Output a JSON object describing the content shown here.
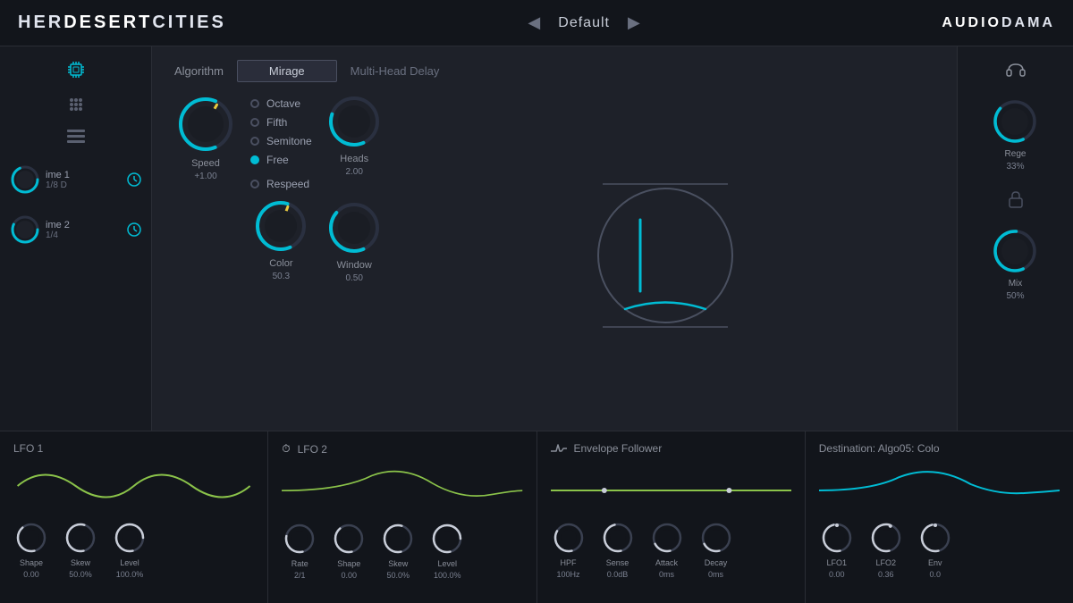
{
  "header": {
    "title_part1": "HER",
    "title_part2": "DESERT",
    "title_part3": "CITIES",
    "preset": "Default",
    "brand_part1": "AUDIO",
    "brand_part2": "DAMA",
    "arrow_left": "◀",
    "arrow_right": "▶"
  },
  "algorithm": {
    "label": "Algorithm",
    "selected": "Mirage",
    "other": "Multi-Head Delay"
  },
  "radio_options": [
    {
      "label": "Octave",
      "active": false
    },
    {
      "label": "Fifth",
      "active": false
    },
    {
      "label": "Semitone",
      "active": false
    },
    {
      "label": "Free",
      "active": true
    }
  ],
  "respeed": {
    "label": "Respeed",
    "active": false
  },
  "knobs": {
    "speed": {
      "label": "Speed",
      "value": "+1.00"
    },
    "color": {
      "label": "Color",
      "value": "50.3"
    },
    "heads": {
      "label": "Heads",
      "value": "2.00"
    },
    "window": {
      "label": "Window",
      "value": "0.50"
    }
  },
  "left_knobs": [
    {
      "label": "me 1",
      "sublabel": "1/8 D"
    },
    {
      "label": "me 2",
      "sublabel": "1/4"
    }
  ],
  "right_knobs": [
    {
      "label": "Rege",
      "sublabel": "33%"
    },
    {
      "label": "Mix",
      "sublabel": "50%"
    }
  ],
  "bottom_panels": [
    {
      "id": "lfo1",
      "title": "LFO 1",
      "has_icon": false,
      "knobs": [
        {
          "label": "Shape",
          "value": "0.00"
        },
        {
          "label": "Skew",
          "value": "50.0%"
        },
        {
          "label": "Level",
          "value": "100.0%"
        }
      ]
    },
    {
      "id": "lfo2",
      "title": "LFO 2",
      "has_icon": true,
      "icon": "⏱",
      "knobs": [
        {
          "label": "Rate",
          "value": "2/1"
        },
        {
          "label": "Shape",
          "value": "0.00"
        },
        {
          "label": "Skew",
          "value": "50.0%"
        },
        {
          "label": "Level",
          "value": "100.0%"
        }
      ]
    },
    {
      "id": "envelope",
      "title": "Envelope Follower",
      "has_icon": true,
      "icon": "⤵",
      "knobs": [
        {
          "label": "HPF",
          "value": "100Hz"
        },
        {
          "label": "Sense",
          "value": "0.0dB"
        },
        {
          "label": "Attack",
          "value": "0ms"
        },
        {
          "label": "Decay",
          "value": "0ms"
        }
      ]
    },
    {
      "id": "destination",
      "title": "Destination: Algo05: Colo",
      "has_icon": false,
      "knobs": [
        {
          "label": "LFO1",
          "value": "0.00"
        },
        {
          "label": "LFO2",
          "value": "0.36"
        },
        {
          "label": "Env",
          "value": "0.0"
        }
      ]
    }
  ],
  "colors": {
    "accent": "#00bcd4",
    "accent_green": "#8bc34a",
    "background_dark": "#12151b",
    "background_mid": "#1a1d24",
    "background_panel": "#1e2129",
    "border": "#2a2d35",
    "text_muted": "#6a7080",
    "text_label": "#8a8f9a",
    "knob_track": "#2a3040"
  }
}
